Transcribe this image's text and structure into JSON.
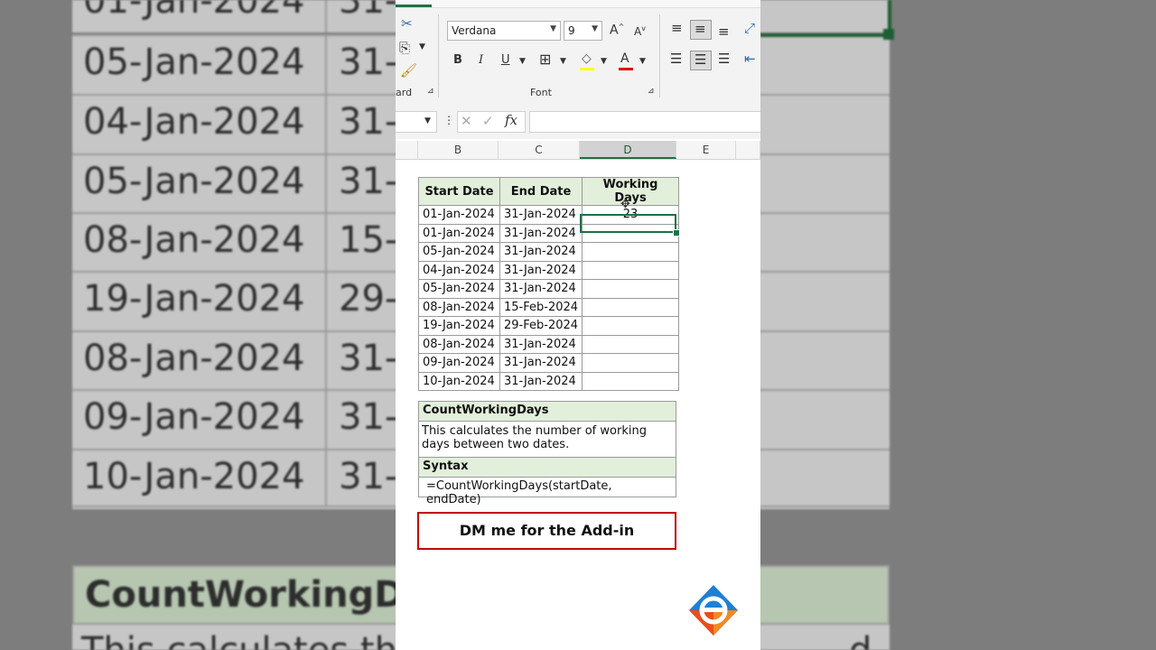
{
  "ribbon": {
    "font_name": "Verdana",
    "font_size": "9",
    "font_group_label": "Font",
    "clipboard_group_label": "ard",
    "bold": "B",
    "italic": "I",
    "underline": "U",
    "grow_font": "A",
    "shrink_font": "A",
    "font_color_letter": "A"
  },
  "formula_bar": {
    "fx": "fx",
    "value": ""
  },
  "columns": [
    "B",
    "C",
    "D",
    "E"
  ],
  "table": {
    "headers": [
      "Start Date",
      "End Date",
      "Working Days"
    ],
    "rows": [
      [
        "01-Jan-2024",
        "31-Jan-2024",
        "23"
      ],
      [
        "01-Jan-2024",
        "31-Jan-2024",
        ""
      ],
      [
        "05-Jan-2024",
        "31-Jan-2024",
        ""
      ],
      [
        "04-Jan-2024",
        "31-Jan-2024",
        ""
      ],
      [
        "05-Jan-2024",
        "31-Jan-2024",
        ""
      ],
      [
        "08-Jan-2024",
        "15-Feb-2024",
        ""
      ],
      [
        "19-Jan-2024",
        "29-Feb-2024",
        ""
      ],
      [
        "08-Jan-2024",
        "31-Jan-2024",
        ""
      ],
      [
        "09-Jan-2024",
        "31-Jan-2024",
        ""
      ],
      [
        "10-Jan-2024",
        "31-Jan-2024",
        ""
      ]
    ]
  },
  "function_box": {
    "name": "CountWorkingDays",
    "description": "This calculates the number of working days between two dates.",
    "syntax_label": "Syntax",
    "syntax": "=CountWorkingDays(startDate, endDate)"
  },
  "cta": "DM me for the Add-in",
  "background": {
    "rows": [
      [
        "01-Jan-2024",
        "31-"
      ],
      [
        "05-Jan-2024",
        "31-"
      ],
      [
        "04-Jan-2024",
        "31-"
      ],
      [
        "05-Jan-2024",
        "31-"
      ],
      [
        "08-Jan-2024",
        "15-"
      ],
      [
        "19-Jan-2024",
        "29-"
      ],
      [
        "08-Jan-2024",
        "31-"
      ],
      [
        "09-Jan-2024",
        "31-"
      ],
      [
        "10-Jan-2024",
        "31-"
      ]
    ],
    "func_name": "CountWorkingDa",
    "desc_start": "This calculates the",
    "desc_end": "d"
  },
  "colors": {
    "accent_green": "#1e7145",
    "header_fill": "#e2efda",
    "cta_border": "#c00000"
  }
}
